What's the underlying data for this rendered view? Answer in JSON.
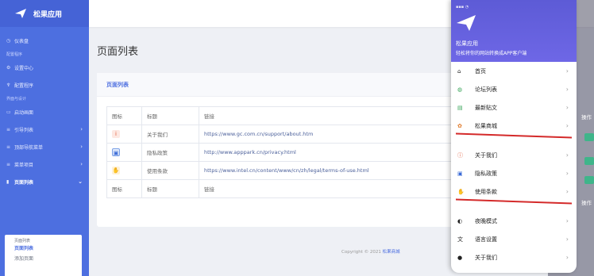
{
  "sidebar": {
    "brand": "松果应用",
    "items": [
      {
        "type": "item",
        "label": "仪表盘",
        "icon": "dashboard-icon"
      },
      {
        "type": "section",
        "label": "配置程序"
      },
      {
        "type": "item",
        "label": "设置中心",
        "icon": "settings-icon"
      },
      {
        "type": "item",
        "label": "配置程序",
        "icon": "config-icon"
      },
      {
        "type": "section",
        "label": "界面与设计"
      },
      {
        "type": "item",
        "label": "启动画面",
        "icon": "image-icon"
      },
      {
        "type": "item",
        "label": "引导列表",
        "icon": "list-icon",
        "arrow": true
      },
      {
        "type": "item",
        "label": "顶部导航菜单",
        "icon": "menu-icon",
        "arrow": true
      },
      {
        "type": "item",
        "label": "菜单项目",
        "icon": "menu-icon",
        "arrow": true
      },
      {
        "type": "item",
        "label": "页面列表",
        "icon": "page-icon",
        "arrow": true,
        "active": true
      }
    ],
    "submenu": [
      "页面列表",
      "页面列表",
      "添加页面"
    ]
  },
  "main": {
    "title": "页面列表",
    "card_title": "页面列表",
    "table": {
      "headers": [
        "图标",
        "标题",
        "链接"
      ],
      "rows": [
        {
          "icon": "info-icon",
          "title": "关于我们",
          "link": "https://www.gc.com.cn/support/about.htm"
        },
        {
          "icon": "privacy-icon",
          "title": "隐私政策",
          "link": "http://www.apppark.cn/privacy.html"
        },
        {
          "icon": "terms-icon",
          "title": "使用条款",
          "link": "https://www.intel.cn/content/www/cn/zh/legal/terms-of-use.html"
        }
      ],
      "footer": [
        "图标",
        "标题",
        "链接"
      ]
    },
    "copyright": "Copyright © 2021",
    "copyright_brand": "松果商城"
  },
  "phone": {
    "title": "松果应用",
    "subtitle": "轻松将你的网站转换成APP客户端",
    "menu1": [
      {
        "label": "首页",
        "icon": "home-icon"
      },
      {
        "label": "论坛列表",
        "icon": "forum-icon"
      },
      {
        "label": "最新贴文",
        "icon": "post-icon"
      },
      {
        "label": "松果商城",
        "icon": "shop-icon"
      }
    ],
    "menu2": [
      {
        "label": "关于我们",
        "icon": "info-icon"
      },
      {
        "label": "隐私政策",
        "icon": "privacy-icon"
      },
      {
        "label": "使用条款",
        "icon": "terms-icon"
      }
    ],
    "menu3": [
      {
        "label": "夜晚模式",
        "icon": "night-icon"
      },
      {
        "label": "语言设置",
        "icon": "language-icon"
      },
      {
        "label": "关于我们",
        "icon": "info-icon"
      }
    ]
  },
  "right": {
    "ops": "操作",
    "ops2": "操作"
  },
  "colors": {
    "accent": "#4d6fe0",
    "phone_header": "#6563df",
    "divider": "#d42a2a"
  }
}
